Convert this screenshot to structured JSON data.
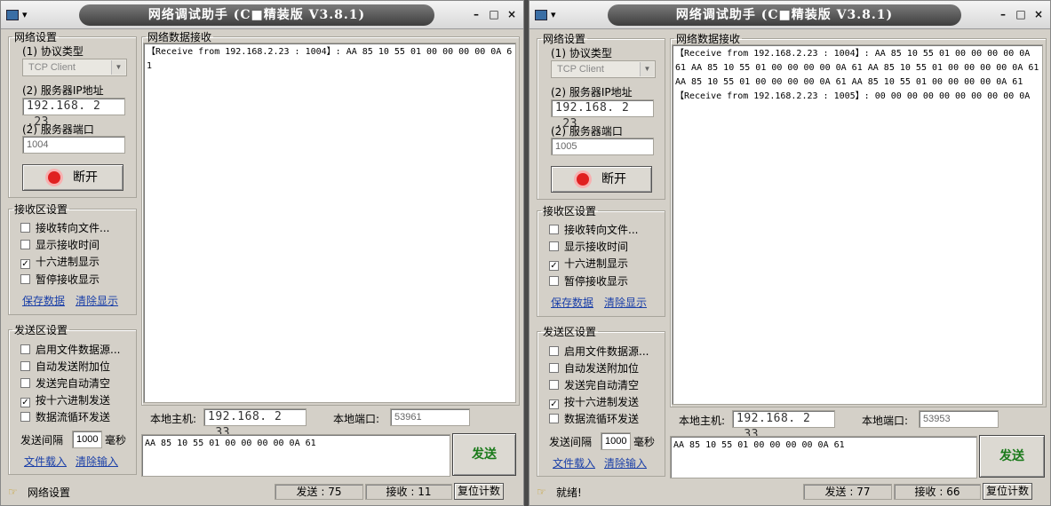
{
  "windows": [
    {
      "title": "网络调试助手 (C■精装版 V3.8.1)",
      "net_group": "网络设置",
      "protocol_label": "(1) 协议类型",
      "protocol_value": "TCP Client",
      "ip_label": "(2) 服务器IP地址",
      "ip_value": "192.168. 2 .23",
      "port_label": "(2) 服务器端口",
      "port_value": "1004",
      "disconnect_label": "断开",
      "recv_group": "接收区设置",
      "recv_options": [
        {
          "label": "接收转向文件...",
          "checked": false
        },
        {
          "label": "显示接收时间",
          "checked": false
        },
        {
          "label": "十六进制显示",
          "checked": true
        },
        {
          "label": "暂停接收显示",
          "checked": false
        }
      ],
      "save_data": "保存数据",
      "clear_display": "清除显示",
      "send_group": "发送区设置",
      "send_options": [
        {
          "label": "启用文件数据源...",
          "checked": false
        },
        {
          "label": "自动发送附加位",
          "checked": false
        },
        {
          "label": "发送完自动清空",
          "checked": false
        },
        {
          "label": "按十六进制发送",
          "checked": true
        },
        {
          "label": "数据流循环发送",
          "checked": false
        }
      ],
      "interval_label": "发送间隔",
      "interval_value": "1000",
      "interval_unit": "毫秒",
      "file_load": "文件载入",
      "clear_input": "清除输入",
      "data_area_label": "网络数据接收",
      "recv_text": "【Receive from 192.168.2.23 : 1004】: AA 85 10 55 01 00 00 00 00 0A 61",
      "local_host_label": "本地主机:",
      "local_host_value": "192.168. 2 .33",
      "local_port_label": "本地端口:",
      "local_port_value": "53961",
      "send_text": "AA 85 10 55 01 00 00 00 00 0A 61",
      "send_button": "发送",
      "status_msg": "网络设置",
      "sent_count": "发送 : 75",
      "recv_count": "接收 : 11",
      "reset_count": "复位计数"
    },
    {
      "title": "网络调试助手 (C■精装版 V3.8.1)",
      "net_group": "网络设置",
      "protocol_label": "(1) 协议类型",
      "protocol_value": "TCP Client",
      "ip_label": "(2) 服务器IP地址",
      "ip_value": "192.168. 2 .23",
      "port_label": "(2) 服务器端口",
      "port_value": "1005",
      "disconnect_label": "断开",
      "recv_group": "接收区设置",
      "recv_options": [
        {
          "label": "接收转向文件...",
          "checked": false
        },
        {
          "label": "显示接收时间",
          "checked": false
        },
        {
          "label": "十六进制显示",
          "checked": true
        },
        {
          "label": "暂停接收显示",
          "checked": false
        }
      ],
      "save_data": "保存数据",
      "clear_display": "清除显示",
      "send_group": "发送区设置",
      "send_options": [
        {
          "label": "启用文件数据源...",
          "checked": false
        },
        {
          "label": "自动发送附加位",
          "checked": false
        },
        {
          "label": "发送完自动清空",
          "checked": false
        },
        {
          "label": "按十六进制发送",
          "checked": true
        },
        {
          "label": "数据流循环发送",
          "checked": false
        }
      ],
      "interval_label": "发送间隔",
      "interval_value": "1000",
      "interval_unit": "毫秒",
      "file_load": "文件载入",
      "clear_input": "清除输入",
      "data_area_label": "网络数据接收",
      "recv_text": "【Receive from 192.168.2.23 : 1004】: AA 85 10 55 01 00 00 00 00 0A 61 AA 85 10 55 01 00 00 00 00 0A 61 AA 85 10 55 01 00 00 00 00 0A 61 AA 85 10 55 01 00 00 00 00 0A 61 AA 85 10 55 01 00 00 00 00 0A 61 【Receive from 192.168.2.23 : 1005】: 00 00 00 00 00 00 00 00 00 0A",
      "local_host_label": "本地主机:",
      "local_host_value": "192.168. 2 .33",
      "local_port_label": "本地端口:",
      "local_port_value": "53953",
      "send_text": "AA 85 10 55 01 00 00 00 00 0A 61",
      "send_button": "发送",
      "status_msg": "就绪!",
      "sent_count": "发送 : 77",
      "recv_count": "接收 : 66",
      "reset_count": "复位计数"
    }
  ]
}
